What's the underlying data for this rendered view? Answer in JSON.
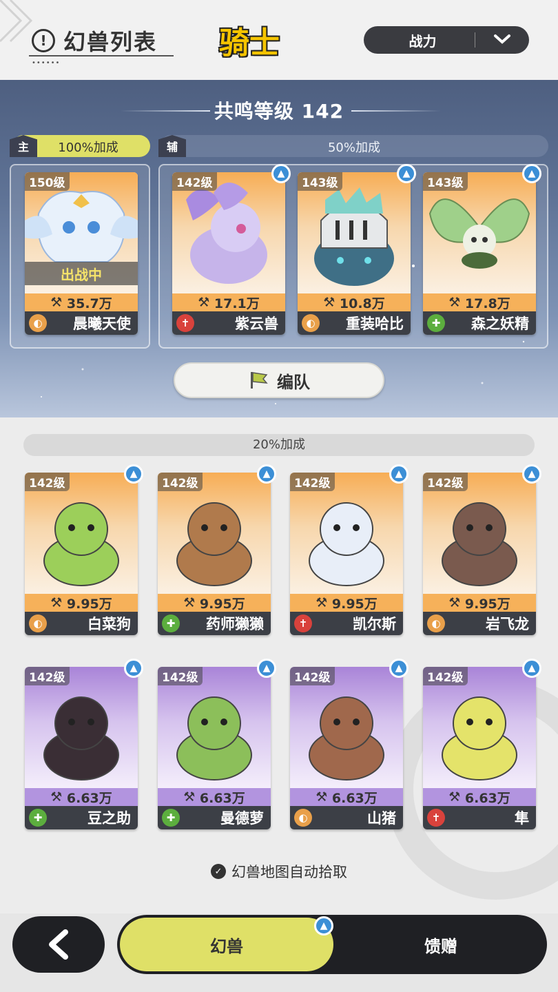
{
  "header": {
    "title": "幻兽列表",
    "title_icon": "exclamation-circle-icon",
    "class_label": "骑士",
    "sort_label": "战力",
    "sort_icon": "chevron-down-icon"
  },
  "resonance": {
    "label": "共鸣等级 142",
    "main_tag": "主",
    "main_bonus": "100%加成",
    "sub_tag": "辅",
    "sub_bonus": "50%加成"
  },
  "main_beast": {
    "level": "150级",
    "status": "出战中",
    "power": "35.7万",
    "name": "晨曦天使",
    "role": "tank"
  },
  "support_beasts": [
    {
      "level": "142级",
      "power": "17.1万",
      "name": "紫云兽",
      "role": "dps",
      "upgradable": true
    },
    {
      "level": "143级",
      "power": "10.8万",
      "name": "重装哈比",
      "role": "tank",
      "upgradable": true
    },
    {
      "level": "143级",
      "power": "17.8万",
      "name": "森之妖精",
      "role": "heal",
      "upgradable": true
    }
  ],
  "team_button": {
    "label": "编队",
    "icon": "flag-icon"
  },
  "reserve": {
    "bonus": "20%加成",
    "beasts": [
      {
        "level": "142级",
        "power": "9.95万",
        "name": "白菜狗",
        "role": "tank",
        "rarity": "orange",
        "color": "#9ccf5a"
      },
      {
        "level": "142级",
        "power": "9.95万",
        "name": "药师獭獭",
        "role": "heal",
        "rarity": "orange",
        "color": "#b07a4c"
      },
      {
        "level": "142级",
        "power": "9.95万",
        "name": "凯尔斯",
        "role": "dps",
        "rarity": "orange",
        "color": "#e8eef8"
      },
      {
        "level": "142级",
        "power": "9.95万",
        "name": "岩飞龙",
        "role": "tank",
        "rarity": "orange",
        "color": "#7a5a4e"
      },
      {
        "level": "142级",
        "power": "6.63万",
        "name": "豆之助",
        "role": "heal",
        "rarity": "purple",
        "color": "#3a2e35"
      },
      {
        "level": "142级",
        "power": "6.63万",
        "name": "曼德萝",
        "role": "heal",
        "rarity": "purple",
        "color": "#8cbf5a"
      },
      {
        "level": "142级",
        "power": "6.63万",
        "name": "山猪",
        "role": "tank",
        "rarity": "purple",
        "color": "#a0684c"
      },
      {
        "level": "142级",
        "power": "6.63万",
        "name": "隼",
        "role": "dps",
        "rarity": "purple",
        "color": "#e4e36a"
      }
    ]
  },
  "auto_pickup": {
    "label": "幻兽地图自动拾取",
    "checked": true
  },
  "bottom_nav": {
    "back_icon": "back-arrow-icon",
    "tab_active": "幻兽",
    "tab_inactive": "馈赠"
  },
  "colors": {
    "accent": "#dfe067",
    "dark": "#1f2024",
    "upgrade": "#3c8fd6"
  }
}
